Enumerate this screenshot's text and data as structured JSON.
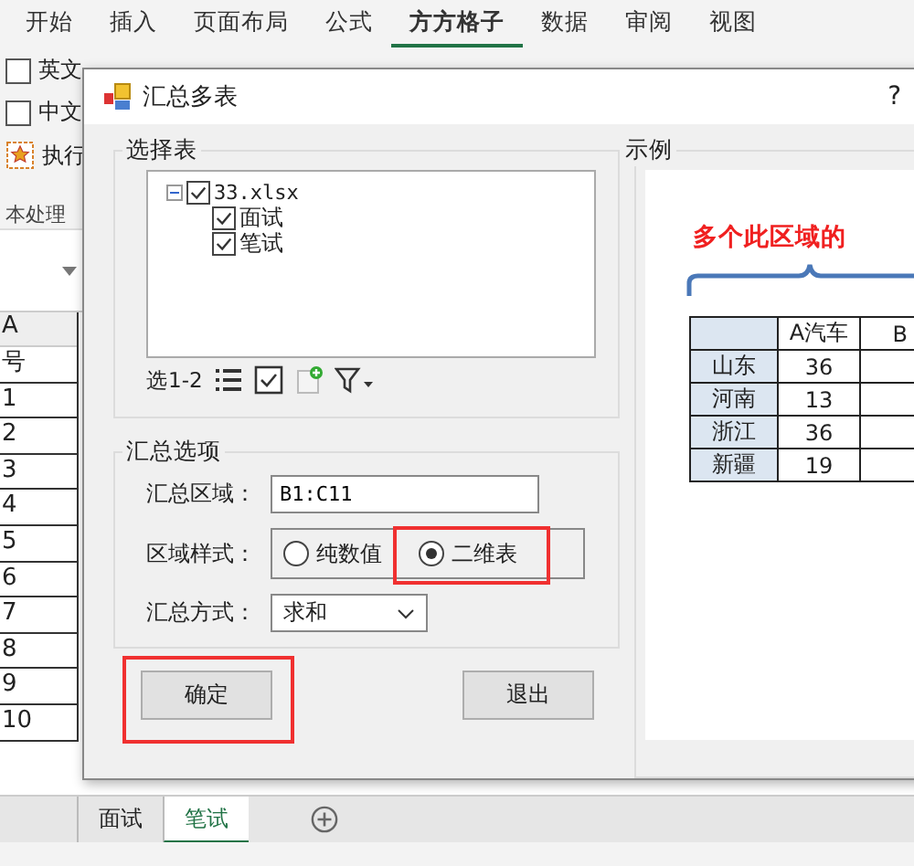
{
  "ribbon": {
    "tabs": [
      {
        "label": "开始",
        "selected": false
      },
      {
        "label": "插入",
        "selected": false
      },
      {
        "label": "页面布局",
        "selected": false
      },
      {
        "label": "公式",
        "selected": false
      },
      {
        "label": "方方格子",
        "selected": true
      },
      {
        "label": "数据",
        "selected": false
      },
      {
        "label": "审阅",
        "selected": false
      },
      {
        "label": "视图",
        "selected": false
      }
    ],
    "options": [
      {
        "kind": "checkbox",
        "label": "英文",
        "checked": false
      },
      {
        "kind": "checkbox",
        "label": "中文",
        "checked": false
      },
      {
        "kind": "action",
        "label": "执行"
      }
    ],
    "group_label": "本处理"
  },
  "sheet": {
    "column": "A",
    "header": "号",
    "rows": [
      "1",
      "2",
      "3",
      "4",
      "5",
      "6",
      "7",
      "8",
      "9",
      "10"
    ]
  },
  "dialog": {
    "title": "汇总多表",
    "help": "?",
    "select_group": {
      "title": "选择表",
      "tree": [
        {
          "label": "33.xlsx",
          "checked": true,
          "expanded": true,
          "children": [
            {
              "label": "面试",
              "checked": true
            },
            {
              "label": "笔试",
              "checked": true
            }
          ]
        }
      ],
      "selection_count": "选1-2"
    },
    "options_group": {
      "title": "汇总选项",
      "range_label": "汇总区域：",
      "range_value": "B1:C11",
      "style_label": "区域样式：",
      "styles": [
        {
          "label": "纯数值",
          "selected": false,
          "highlighted": false
        },
        {
          "label": "二维表",
          "selected": true,
          "highlighted": true
        }
      ],
      "method_label": "汇总方式：",
      "method_value": "求和"
    },
    "buttons": [
      {
        "label": "确定",
        "highlighted": true
      },
      {
        "label": "退出",
        "highlighted": false
      }
    ],
    "example": {
      "title": "示例",
      "caption": "多个此区域的",
      "columns": [
        "A汽车",
        "B"
      ],
      "rows": [
        {
          "name": "山东",
          "value": "36"
        },
        {
          "name": "河南",
          "value": "13"
        },
        {
          "name": "浙江",
          "value": "36"
        },
        {
          "name": "新疆",
          "value": "19"
        }
      ]
    }
  },
  "sheet_tabs": [
    {
      "label": "面试",
      "selected": false
    },
    {
      "label": "笔试",
      "selected": true
    }
  ]
}
